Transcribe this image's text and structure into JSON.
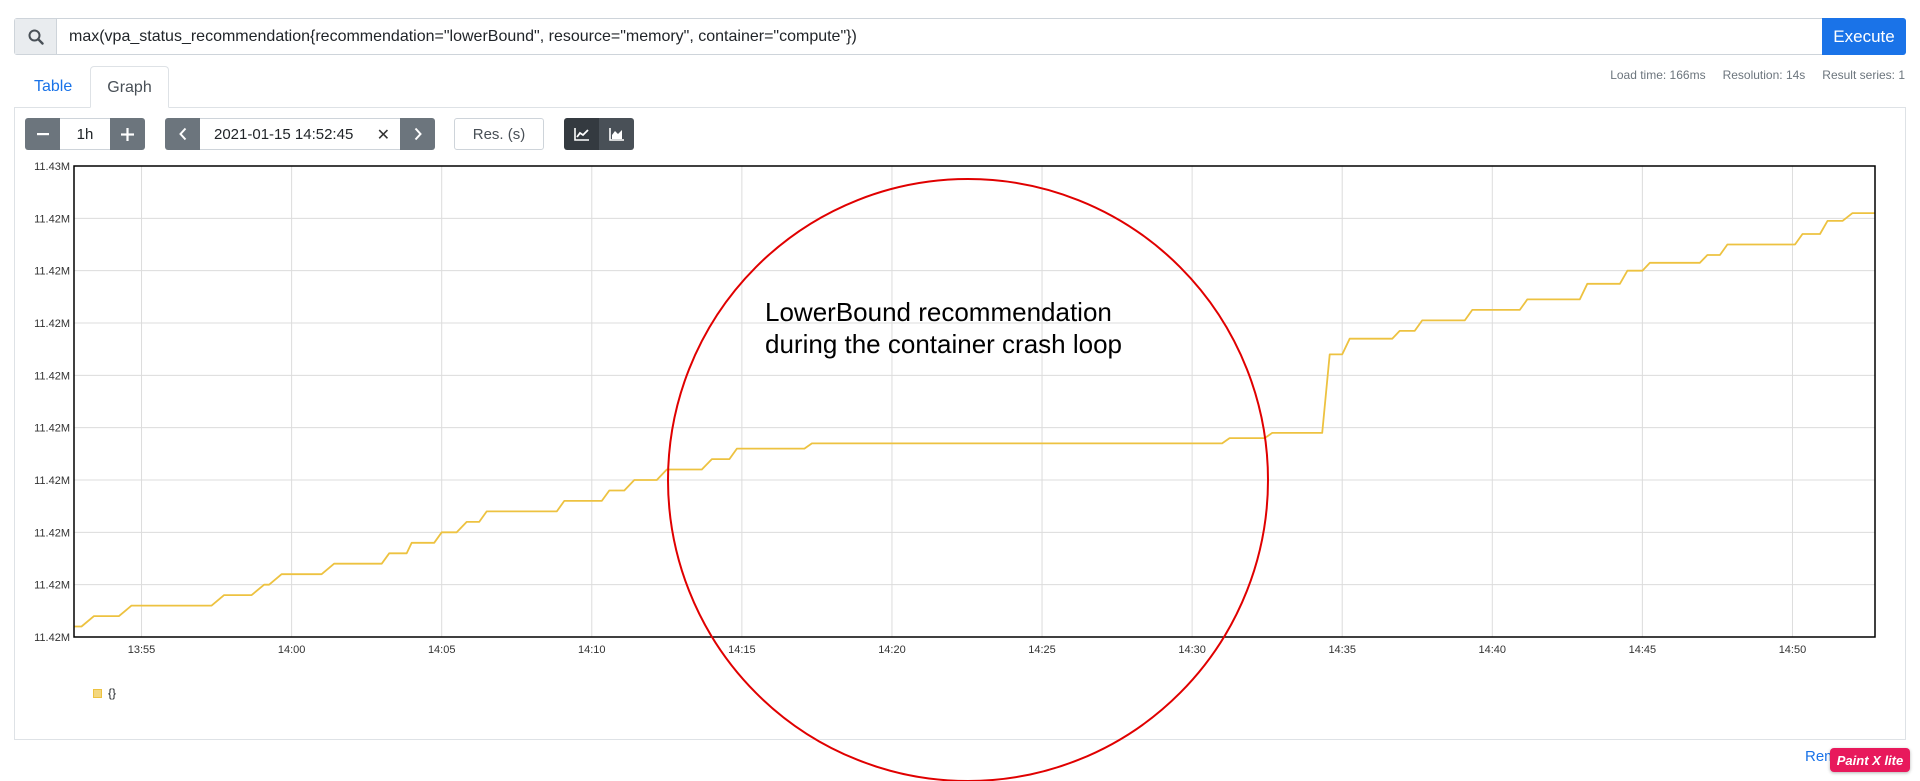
{
  "query": {
    "expression": "max(vpa_status_recommendation{recommendation=\"lowerBound\", resource=\"memory\", container=\"compute\"})",
    "execute_label": "Execute"
  },
  "tabs": [
    {
      "label": "Table",
      "active": false
    },
    {
      "label": "Graph",
      "active": true
    }
  ],
  "stats": {
    "load_time": "Load time: 166ms",
    "resolution": "Resolution: 14s",
    "result_series": "Result series: 1"
  },
  "controls": {
    "range": "1h",
    "end_time": "2021-01-15 14:52:45",
    "resolution_placeholder": "Res. (s)"
  },
  "annotation": {
    "line1": "LowerBound recommendation",
    "line2": "during the container crash loop"
  },
  "legend": {
    "label": "{}"
  },
  "footer": {
    "remove_label": "Rem"
  },
  "watermark": {
    "text": "Paint X lite"
  },
  "colors": {
    "series": "#edc240",
    "annotation_circle": "#e00000",
    "execute": "#1a73e8"
  },
  "chart_data": {
    "type": "line",
    "title": "",
    "xlabel": "",
    "ylabel": "",
    "y_tick_labels": [
      "11.43M",
      "11.42M",
      "11.42M",
      "11.42M",
      "11.42M",
      "11.42M",
      "11.42M",
      "11.42M",
      "11.42M",
      "11.42M"
    ],
    "x_tick_labels": [
      "13:55",
      "14:00",
      "14:05",
      "14:10",
      "14:15",
      "14:20",
      "14:25",
      "14:30",
      "14:35",
      "14:40",
      "14:45",
      "14:50"
    ],
    "x_range_minutes": [
      "13:52:45",
      "14:52:45"
    ],
    "y_level_range": [
      0,
      9
    ],
    "grid": true,
    "series": [
      {
        "name": "{}",
        "x": [
          "13:52:45",
          "13:53:00",
          "13:53:25",
          "13:54:15",
          "13:54:40",
          "13:55:40",
          "13:56:05",
          "13:57:20",
          "13:57:45",
          "13:58:40",
          "13:59:05",
          "13:59:15",
          "13:59:40",
          "14:01:00",
          "14:01:25",
          "14:03:00",
          "14:03:15",
          "14:03:50",
          "14:04:00",
          "14:04:45",
          "14:05:00",
          "14:05:30",
          "14:05:50",
          "14:06:15",
          "14:06:30",
          "14:08:50",
          "14:09:05",
          "14:10:20",
          "14:10:35",
          "14:11:05",
          "14:11:25",
          "14:12:10",
          "14:12:30",
          "14:13:40",
          "14:14:00",
          "14:14:35",
          "14:14:50",
          "14:17:05",
          "14:17:20",
          "14:31:00",
          "14:31:15",
          "14:32:25",
          "14:32:40",
          "14:34:20",
          "14:34:35",
          "14:35:00",
          "14:35:15",
          "14:36:40",
          "14:36:55",
          "14:37:25",
          "14:37:40",
          "14:39:05",
          "14:39:20",
          "14:40:55",
          "14:41:10",
          "14:42:55",
          "14:43:10",
          "14:44:15",
          "14:44:30",
          "14:45:00",
          "14:45:15",
          "14:46:55",
          "14:47:10",
          "14:47:35",
          "14:47:50",
          "14:50:05",
          "14:50:20",
          "14:50:55",
          "14:51:10",
          "14:51:40",
          "14:52:00",
          "14:52:45"
        ],
        "y": [
          0.2,
          0.2,
          0.4,
          0.4,
          0.6,
          0.6,
          0.6,
          0.6,
          0.8,
          0.8,
          1.0,
          1.0,
          1.2,
          1.2,
          1.4,
          1.4,
          1.6,
          1.6,
          1.8,
          1.8,
          2.0,
          2.0,
          2.2,
          2.2,
          2.4,
          2.4,
          2.6,
          2.6,
          2.8,
          2.8,
          3.0,
          3.0,
          3.2,
          3.2,
          3.4,
          3.4,
          3.6,
          3.6,
          3.7,
          3.7,
          3.8,
          3.8,
          3.9,
          3.9,
          5.4,
          5.4,
          5.7,
          5.7,
          5.85,
          5.85,
          6.05,
          6.05,
          6.25,
          6.25,
          6.45,
          6.45,
          6.75,
          6.75,
          7.0,
          7.0,
          7.15,
          7.15,
          7.3,
          7.3,
          7.5,
          7.5,
          7.7,
          7.7,
          7.95,
          7.95,
          8.1,
          8.1
        ]
      }
    ]
  }
}
